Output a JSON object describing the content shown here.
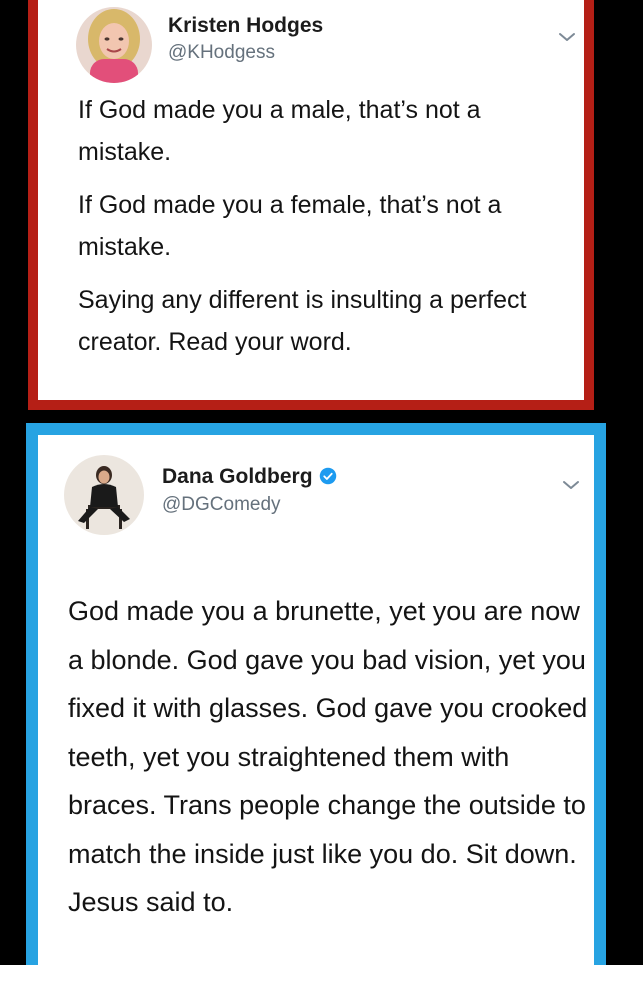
{
  "tweets": [
    {
      "author": {
        "name": "Kristen Hodges",
        "handle": "@KHodgess",
        "verified": false
      },
      "paragraphs": [
        "If God made you a male, that’s not a mistake.",
        "If God made you a female, that’s not a mistake.",
        "Saying any different is insulting a perfect creator. Read your word."
      ],
      "frame_color": "#b51f16"
    },
    {
      "author": {
        "name": "Dana Goldberg",
        "handle": "@DGComedy",
        "verified": true
      },
      "paragraphs": [
        "God made you a brunette, yet you are now a blonde. God gave you bad vision, yet you fixed it with glasses. God gave you crooked teeth, yet you straightened them with braces. Trans people change the outside to match the inside just like you do. Sit down. Jesus said to."
      ],
      "frame_color": "#27a3e2"
    }
  ],
  "icons": {
    "menu": "chevron-down-icon",
    "verified": "verified-badge-icon"
  },
  "colors": {
    "background": "#000000",
    "verified_blue": "#1d9bf0"
  }
}
